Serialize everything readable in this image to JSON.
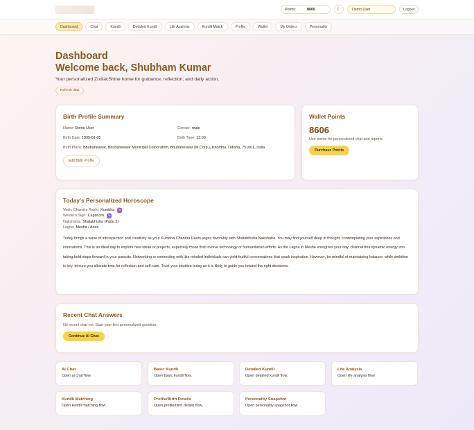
{
  "header": {
    "points_label": "Points:",
    "points_value": "8606",
    "theme_icon": "moon-icon",
    "theme_glyph": "☾",
    "user_value": "Demo User",
    "logout_label": "Logout"
  },
  "nav": {
    "tabs": [
      {
        "label": "Dashboard",
        "active": true
      },
      {
        "label": "Chat"
      },
      {
        "label": "Kundli"
      },
      {
        "label": "Detailed Kundli"
      },
      {
        "label": "Life Analysis"
      },
      {
        "label": "Kundli Match"
      },
      {
        "label": "Profile"
      },
      {
        "label": "Wallet"
      },
      {
        "label": "My Orders"
      },
      {
        "label": "Personality"
      }
    ]
  },
  "hero": {
    "title": "Dashboard",
    "welcome": "Welcome back, Shubham Kumar",
    "subtitle": "Your personalized ZodiacShine home for guidance, reflection, and daily action.",
    "refresh_label": "Refresh data"
  },
  "birth_profile": {
    "title": "Birth Profile Summary",
    "name_label": "Name:",
    "name_value": "Demo User",
    "gender_label": "Gender:",
    "gender_value": "male",
    "date_label": "Birth Date:",
    "date_value": "1995-01-05",
    "time_label": "Birth Time:",
    "time_value": "13:00",
    "place_label": "Birth Place:",
    "place_value": "Bhubaneswar, Bhubaneswar Municipal Corporation, Bhubaneswar (M.Corp.), Khordha, Odisha, 751001, India",
    "edit_label": "Edit Birth Profile"
  },
  "wallet": {
    "title": "Wallet Points",
    "points": "8606",
    "note": "Use points for personalized chat and reports.",
    "purchase_label": "Purchase Points"
  },
  "horoscope": {
    "title": "Today's Personalized Horoscope",
    "vedic_label": "Vedic Chandra Rashi:",
    "vedic_value": "Kumbha",
    "vedic_glyph": "♒",
    "western_label": "Western Sign:",
    "western_value": "Capricorn",
    "western_glyph": "♑",
    "nakshatra_label": "Nakshatra:",
    "nakshatra_value": "Shatabhisha (Pada 2)",
    "lagna_label": "Lagna:",
    "lagna_value": "Mesha / Aries",
    "text": "Today brings a wave of introspection and creativity as your Kumbha Chandra Rashi aligns favorably with Shatabhisha Nakshatra. You may find yourself deep in thought, contemplating your aspirations and innovations. This is an ideal day to explore new ideas or projects, especially those that involve technology or humanitarian efforts. As the Lagna in Mesha energizes your day, channel this dynamic energy into taking bold steps forward in your pursuits. Networking or connecting with like-minded individuals can yield fruitful conversations that spark inspiration. However, be mindful of maintaining balance; while ambition is key, ensure you allocate time for reflection and self-care. Trust your intuition today as it is likely to guide you toward the right decisions."
  },
  "recent_chat": {
    "title": "Recent Chat Answers",
    "empty": "No recent chat yet. Start your first personalized question.",
    "continue_label": "Continue AI Chat"
  },
  "quick_links": [
    {
      "title": "AI Chat",
      "desc": "Open ai chat flow."
    },
    {
      "title": "Basic Kundli",
      "desc": "Open basic kundli flow."
    },
    {
      "title": "Detailed Kundli",
      "desc": "Open detailed kundli flow."
    },
    {
      "title": "Life Analysis",
      "desc": "Open life analysis flow."
    },
    {
      "title": "Kundli Matching",
      "desc": "Open kundli matching flow."
    },
    {
      "title": "Profile/Birth Details",
      "desc": "Open profile/birth details flow."
    },
    {
      "title": "Personality Snapshot",
      "desc": "Open personality snapshot flow."
    }
  ]
}
